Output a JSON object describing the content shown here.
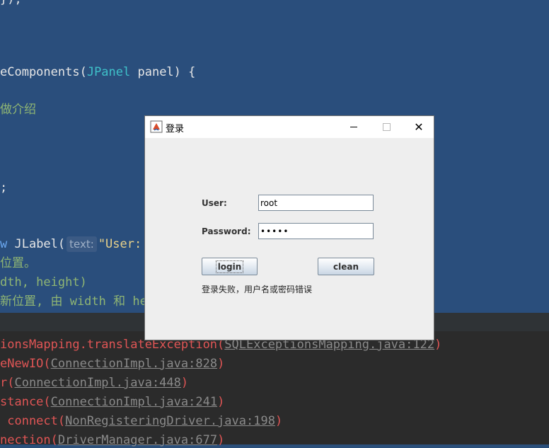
{
  "editor": {
    "lines": [
      {
        "parts": [
          {
            "t": "});",
            "c": "default"
          }
        ]
      },
      {
        "parts": [
          {
            "t": "eComponents(",
            "c": "default"
          },
          {
            "t": "JPanel",
            "c": "type"
          },
          {
            "t": " panel) {",
            "c": "default"
          }
        ]
      },
      {
        "parts": [
          {
            "t": "做介绍",
            "c": "comment"
          }
        ]
      },
      {
        "parts": [
          {
            "t": ";",
            "c": "default"
          }
        ]
      },
      {
        "parts": [
          {
            "t": "w",
            "c": "keyword"
          },
          {
            "t": " JLabel(",
            "c": "default"
          }
        ]
      },
      {
        "parts": [
          {
            "t": "位置。",
            "c": "comment"
          }
        ]
      },
      {
        "parts": [
          {
            "t": "dth, height)",
            "c": "comment"
          }
        ]
      },
      {
        "parts": [
          {
            "t": "新位置, 由 width 和 he",
            "c": "comment"
          }
        ]
      }
    ],
    "hint_label": "text:",
    "string_fragment": "\"User:"
  },
  "console": {
    "lines": [
      {
        "pre": "ionsMapping.translateException(",
        "link": "SQLExceptionsMapping.java:122",
        "post": ")"
      },
      {
        "pre": "eNewIO(",
        "link": "ConnectionImpl.java:828",
        "post": ")"
      },
      {
        "pre": "r(",
        "link": "ConnectionImpl.java:448",
        "post": ")"
      },
      {
        "pre": "stance(",
        "link": "ConnectionImpl.java:241",
        "post": ")"
      },
      {
        "pre": " connect(",
        "link": "NonRegisteringDriver.java:198",
        "post": ")"
      },
      {
        "pre": "nection(",
        "link": "DriverManager.java:677",
        "post": ")"
      }
    ]
  },
  "dialog": {
    "title": "登录",
    "user_label": "User:",
    "user_value": "root",
    "password_label": "Password:",
    "password_value": "•••••",
    "login_label": "login",
    "clean_label": "clean",
    "status": "登录失败，用户名或密码错误"
  }
}
